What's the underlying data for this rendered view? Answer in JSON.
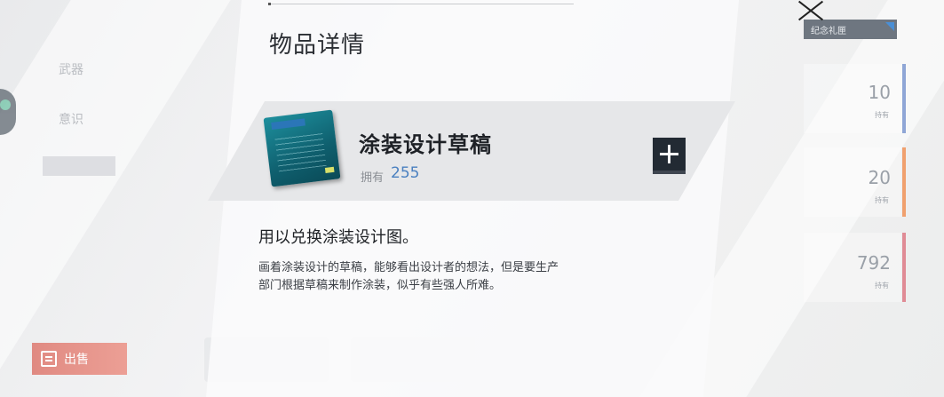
{
  "dialog": {
    "title": "物品详情",
    "item_name": "涂装设计草稿",
    "own_label": "拥有",
    "own_count": "255",
    "desc_heading": "用以兑换涂装设计图。",
    "desc_body_line1": "画着涂装设计的草稿，能够看出设计者的想法，但是要生产",
    "desc_body_line2": "部门根据草稿来制作涂装，似乎有些强人所难。",
    "item_icon": "paint-design-sketch-icon",
    "plus_icon": "plus-icon",
    "close_icon": "close-icon"
  },
  "background": {
    "left_labels": [
      "武器",
      "意识"
    ],
    "right_counts": [
      {
        "value": "10",
        "label": "持有",
        "color": "#8fa6d6"
      },
      {
        "value": "20",
        "label": "持有",
        "color": "#f0a06e"
      },
      {
        "value": "792",
        "label": "持有",
        "color": "#e08b95"
      }
    ],
    "souvenir_button": "纪念礼匣",
    "sell_button": "出售"
  },
  "colors": {
    "accent_blue": "#4a80c0",
    "plus_button": "#222a33",
    "sell_button": "#e8978d"
  }
}
